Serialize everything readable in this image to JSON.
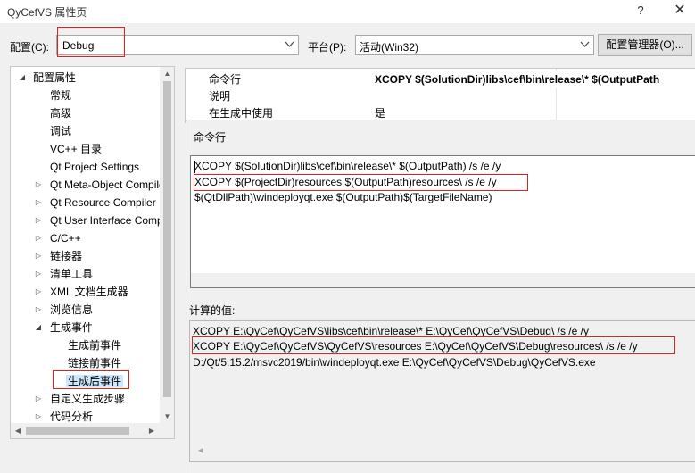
{
  "window": {
    "title": "QyCefVS 属性页",
    "help": "?",
    "close": "✕"
  },
  "config": {
    "label": "配置(C):",
    "value": "Debug"
  },
  "platform": {
    "label": "平台(P):",
    "value": "活动(Win32)"
  },
  "config_manager": {
    "label": "配置管理器(O)..."
  },
  "tree": {
    "items": [
      {
        "label": "配置属性",
        "expander": "◢"
      },
      {
        "label": "常规",
        "expander": ""
      },
      {
        "label": "高级",
        "expander": ""
      },
      {
        "label": "调试",
        "expander": ""
      },
      {
        "label": "VC++ 目录",
        "expander": ""
      },
      {
        "label": "Qt Project Settings",
        "expander": ""
      },
      {
        "label": "Qt Meta-Object Compiler",
        "expander": "▷"
      },
      {
        "label": "Qt Resource Compiler",
        "expander": "▷"
      },
      {
        "label": "Qt User Interface Compiler",
        "expander": "▷"
      },
      {
        "label": "C/C++",
        "expander": "▷"
      },
      {
        "label": "链接器",
        "expander": "▷"
      },
      {
        "label": "清单工具",
        "expander": "▷"
      },
      {
        "label": "XML 文档生成器",
        "expander": "▷"
      },
      {
        "label": "浏览信息",
        "expander": "▷"
      },
      {
        "label": "生成事件",
        "expander": "◢"
      },
      {
        "label": "生成前事件",
        "expander": ""
      },
      {
        "label": "链接前事件",
        "expander": ""
      },
      {
        "label": "生成后事件",
        "expander": ""
      },
      {
        "label": "自定义生成步骤",
        "expander": "▷"
      },
      {
        "label": "代码分析",
        "expander": "▷"
      }
    ],
    "selected": "生成后事件"
  },
  "properties": [
    {
      "name": "命令行",
      "value": "XCOPY $(SolutionDir)libs\\cef\\bin\\release\\* $(OutputPath"
    },
    {
      "name": "说明",
      "value": ""
    },
    {
      "name": "在生成中使用",
      "value": "是"
    }
  ],
  "command_dialog": {
    "title": "命令行",
    "lines": [
      "XCOPY $(SolutionDir)libs\\cef\\bin\\release\\* $(OutputPath) /s /e /y",
      "XCOPY $(ProjectDir)resources $(OutputPath)resources\\ /s /e /y",
      "$(QtDllPath)\\windeployqt.exe $(OutputPath)$(TargetFileName)"
    ],
    "computed_label": "计算的值:",
    "computed_lines": [
      "XCOPY E:\\QyCef\\QyCefVS\\libs\\cef\\bin\\release\\* E:\\QyCef\\QyCefVS\\Debug\\ /s /e /y",
      "XCOPY E:\\QyCef\\QyCefVS\\QyCefVS\\resources E:\\QyCef\\QyCefVS\\Debug\\resources\\ /s /e /y",
      "D:/Qt/5.15.2/msvc2019/bin\\windeployqt.exe E:\\QyCef\\QyCefVS\\Debug\\QyCefVS.exe"
    ]
  },
  "colors": {
    "highlight_border": "#e02020",
    "selection": "#cce8ff"
  }
}
